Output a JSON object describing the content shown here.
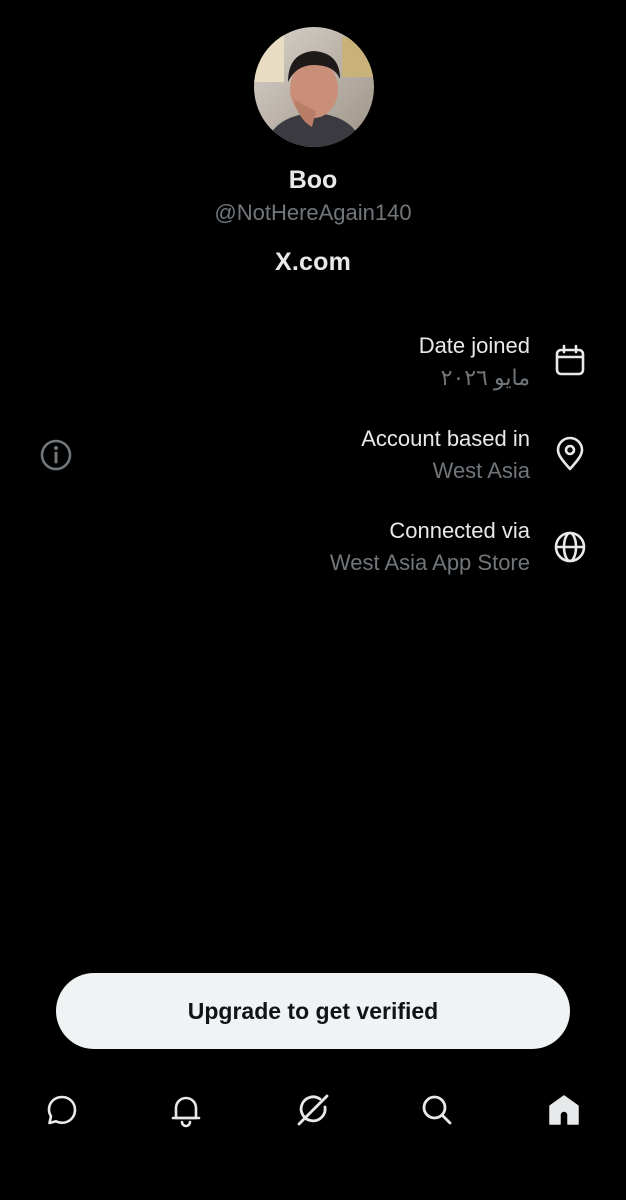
{
  "profile": {
    "name": "Boo",
    "handle": "@NotHereAgain140",
    "domain": "X.com",
    "avatar_icon": "profile-photo"
  },
  "details": [
    {
      "title": "Date joined",
      "value": "مايو ٢٠٢٦",
      "icon": "calendar-icon"
    },
    {
      "title": "Account based in",
      "value": "West Asia",
      "icon": "location-pin-icon"
    },
    {
      "title": "Connected via",
      "value": "West Asia App Store",
      "icon": "globe-icon"
    }
  ],
  "info_icon": "info-icon",
  "upgrade_label": "Upgrade to get verified",
  "nav": [
    {
      "icon": "messages-icon",
      "active": false
    },
    {
      "icon": "notifications-icon",
      "active": false
    },
    {
      "icon": "grok-icon",
      "active": false
    },
    {
      "icon": "search-icon",
      "active": false
    },
    {
      "icon": "home-icon",
      "active": true
    }
  ],
  "colors": {
    "background": "#000000",
    "primary_text": "#e7e9ea",
    "secondary_text": "#71767b",
    "button_bg": "#eff3f4",
    "button_text": "#0f1419"
  }
}
